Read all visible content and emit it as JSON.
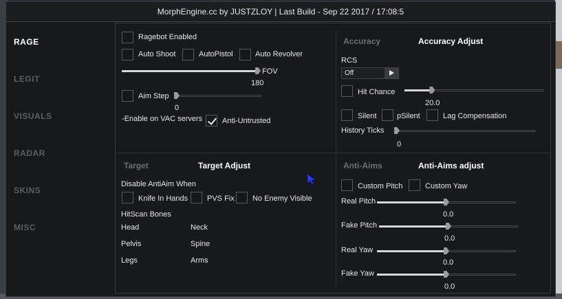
{
  "window": {
    "title": "MorphEngine.cc by JUSTZLOY | Last Build - Sep 22 2017 / 17:08:5"
  },
  "sidebar": {
    "items": [
      {
        "label": "RAGE",
        "active": true
      },
      {
        "label": "LEGIT",
        "active": false
      },
      {
        "label": "VISUALS",
        "active": false
      },
      {
        "label": "RADAR",
        "active": false
      },
      {
        "label": "SKINS",
        "active": false
      },
      {
        "label": "MISC",
        "active": false
      }
    ]
  },
  "rage": {
    "ragebot_enabled": {
      "label": "Ragebot Enabled",
      "checked": false
    },
    "auto_shoot": {
      "label": "Auto Shoot",
      "checked": false
    },
    "auto_pistol": {
      "label": "AutoPistol",
      "checked": false
    },
    "auto_revolver": {
      "label": "Auto Revolver",
      "checked": false
    },
    "fov": {
      "label": "FOV",
      "value": "180",
      "fraction": 1.0
    },
    "aim_step": {
      "label": "Aim Step",
      "checked": false,
      "value": "0",
      "fraction": 0.0
    },
    "vac_text": "-Enable on VAC servers",
    "anti_untrusted": {
      "label": "Anti-Untrusted",
      "checked": true
    }
  },
  "accuracy": {
    "tab_label": "Accuracy",
    "title": "Accuracy Adjust",
    "rcs_label": "RCS",
    "rcs_value": "Off",
    "hit_chance": {
      "label": "Hit Chance",
      "checked": false,
      "value": "20.0",
      "fraction": 0.2
    },
    "silent": {
      "label": "Silent",
      "checked": false
    },
    "psilent": {
      "label": "pSilent",
      "checked": false
    },
    "lag_comp": {
      "label": "Lag Compensation",
      "checked": false
    },
    "history_ticks": {
      "label": "History Ticks",
      "value": "0",
      "fraction": 0.0
    }
  },
  "target": {
    "tab_label": "Target",
    "title": "Target Adjust",
    "disable_label": "Disable AntiAim When",
    "knife": {
      "label": "Knife In Hands",
      "checked": false
    },
    "pvs": {
      "label": "PVS Fix",
      "checked": false
    },
    "no_enemy": {
      "label": "No Enemy Visible",
      "checked": false
    },
    "hitscan_label": "HitScan Bones",
    "bones": [
      "Head",
      "Neck",
      "Pelvis",
      "Spine",
      "Legs",
      "Arms"
    ]
  },
  "antiaim": {
    "tab_label": "Anti-Aims",
    "title": "Anti-Aims adjust",
    "custom_pitch": {
      "label": "Custom Pitch",
      "checked": false
    },
    "custom_yaw": {
      "label": "Custom Yaw",
      "checked": false
    },
    "real_pitch": {
      "label": "Real Pitch",
      "value": "0.0",
      "fraction": 0.5
    },
    "fake_pitch": {
      "label": "Fake Pitch",
      "value": "0.0",
      "fraction": 0.5
    },
    "real_yaw": {
      "label": "Real Yaw",
      "value": "0.0",
      "fraction": 0.5
    },
    "fake_yaw": {
      "label": "Fake Yaw",
      "value": "0.0",
      "fraction": 0.5
    }
  }
}
